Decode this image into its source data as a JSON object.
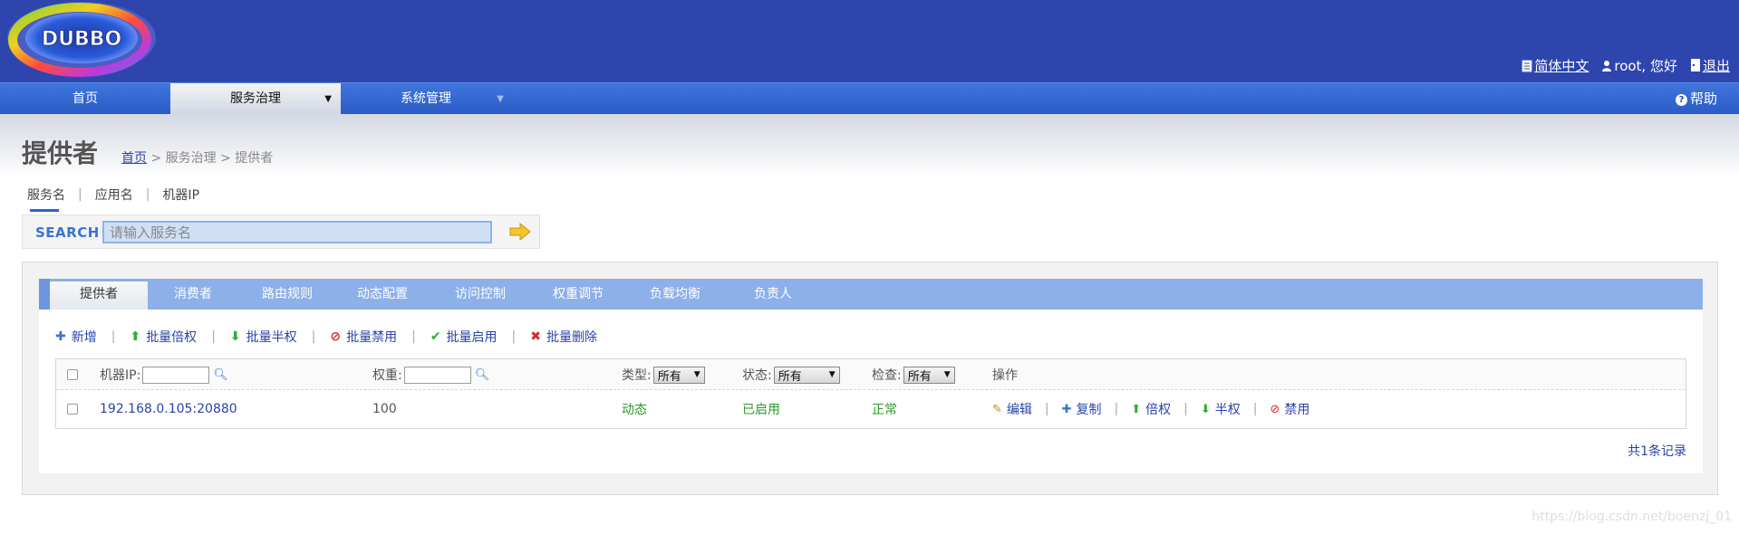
{
  "header": {
    "logo_text": "DUBBO",
    "language_link": "简体中文",
    "greeting": "root, 您好",
    "logout": "退出"
  },
  "nav": {
    "items": [
      {
        "label": "首页"
      },
      {
        "label": "服务治理",
        "caret": "▼"
      },
      {
        "label": "系统管理",
        "caret": "▼"
      }
    ],
    "help": "帮助"
  },
  "page": {
    "title": "提供者",
    "breadcrumb": {
      "home": "首页",
      "rest": " > 服务治理 > 提供者"
    }
  },
  "search": {
    "tabs": [
      "服务名",
      "应用名",
      "机器IP"
    ],
    "separator": "|",
    "label": "SEARCH",
    "placeholder": "请输入服务名"
  },
  "tabs": [
    "提供者",
    "消费者",
    "路由规则",
    "动态配置",
    "访问控制",
    "权重调节",
    "负载均衡",
    "负责人"
  ],
  "toolbar": {
    "separator": "|",
    "items": [
      {
        "icon": "plus-icon",
        "label": "新增",
        "color": "#3a72d6"
      },
      {
        "icon": "arrow-up-icon",
        "label": "批量倍权",
        "color": "#2fae2f"
      },
      {
        "icon": "arrow-down-icon",
        "label": "批量半权",
        "color": "#2fae2f"
      },
      {
        "icon": "ban-icon",
        "label": "批量禁用",
        "color": "#d62a2a"
      },
      {
        "icon": "check-icon",
        "label": "批量启用",
        "color": "#2fae2f"
      },
      {
        "icon": "cross-icon",
        "label": "批量删除",
        "color": "#d62a2a"
      }
    ]
  },
  "table": {
    "headers": {
      "ip": "机器IP:",
      "weight": "权重:",
      "type": "类型:",
      "status": "状态:",
      "check": "检查:",
      "ops": "操作"
    },
    "select_all_option": "所有",
    "rows": [
      {
        "ip": "192.168.0.105:20880",
        "weight": "100",
        "type": "动态",
        "status": "已启用",
        "check": "正常"
      }
    ],
    "row_actions": [
      "编辑",
      "复制",
      "倍权",
      "半权",
      "禁用"
    ],
    "action_separator": "|"
  },
  "footer": {
    "total": "共1条记录",
    "watermark": "https://blog.csdn.net/boenzj_01"
  },
  "colors": {
    "header_bg": "#2f45ae",
    "nav_bg": "#3a6cd6",
    "tab_bg": "#8db0e8",
    "link": "#2a43a8",
    "status_green": "#2a9a2a"
  }
}
